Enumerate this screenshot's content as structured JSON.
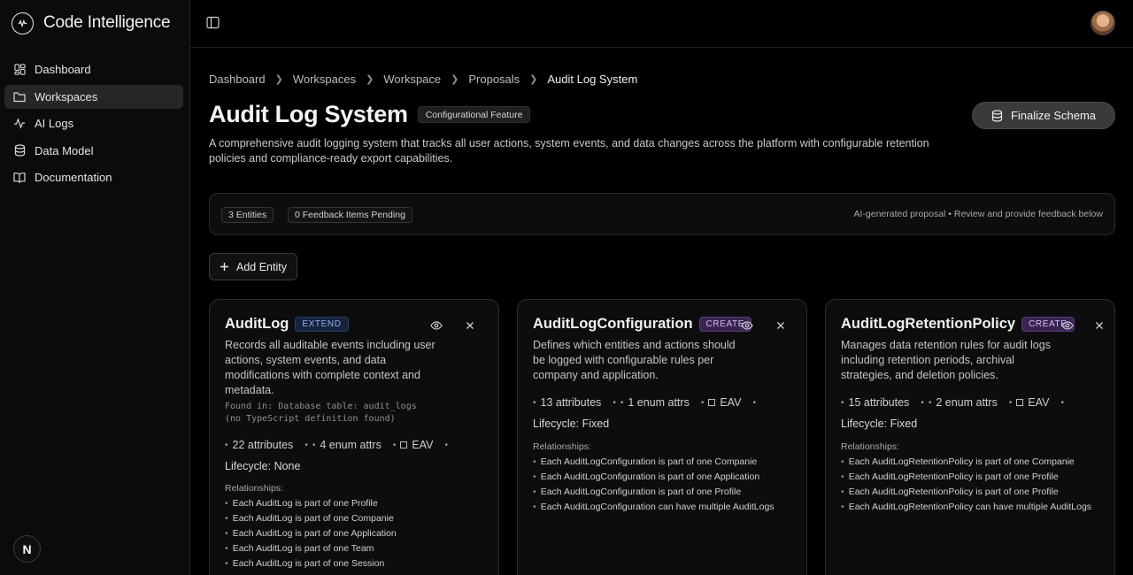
{
  "app": {
    "title": "Code Intelligence"
  },
  "sidebar": {
    "items": [
      {
        "label": "Dashboard",
        "icon": "dashboard-icon",
        "active": false
      },
      {
        "label": "Workspaces",
        "icon": "folder-icon",
        "active": true
      },
      {
        "label": "AI Logs",
        "icon": "activity-icon",
        "active": false
      },
      {
        "label": "Data Model",
        "icon": "database-icon",
        "active": false
      },
      {
        "label": "Documentation",
        "icon": "book-icon",
        "active": false
      }
    ],
    "footer_badge": "N"
  },
  "breadcrumb": [
    "Dashboard",
    "Workspaces",
    "Workspace",
    "Proposals",
    "Audit Log System"
  ],
  "page": {
    "title": "Audit Log System",
    "badge": "Configurational Feature",
    "finalize_label": "Finalize Schema",
    "description": "A comprehensive audit logging system that tracks all user actions, system events, and data changes across the platform with configurable retention policies and compliance-ready export capabilities."
  },
  "summary": {
    "entities": "3 Entities",
    "feedback": "0 Feedback Items Pending",
    "note": "AI-generated proposal • Review and provide feedback below"
  },
  "add_entity_label": "Add Entity",
  "cards": [
    {
      "name": "AuditLog",
      "op": "EXTEND",
      "description": "Records all auditable events including user actions, system events, and data modifications with complete context and metadata.",
      "found": "Found in: Database table: audit_logs\n(no TypeScript definition found)",
      "attributes": "22 attributes",
      "enum_attrs": "4 enum attrs",
      "eav": "EAV",
      "lifecycle": "Lifecycle: None",
      "relationships_title": "Relationships:",
      "relationships": [
        "Each AuditLog is part of one Profile",
        "Each AuditLog is part of one Companie",
        "Each AuditLog is part of one Application",
        "Each AuditLog is part of one Team",
        "Each AuditLog is part of one Session"
      ]
    },
    {
      "name": "AuditLogConfiguration",
      "op": "CREATE",
      "description": "Defines which entities and actions should be logged with configurable rules per company and application.",
      "attributes": "13 attributes",
      "enum_attrs": "1 enum attrs",
      "eav": "EAV",
      "lifecycle": "Lifecycle: Fixed",
      "relationships_title": "Relationships:",
      "relationships": [
        "Each AuditLogConfiguration is part of one Companie",
        "Each AuditLogConfiguration is part of one Application",
        "Each AuditLogConfiguration is part of one Profile",
        "Each AuditLogConfiguration can have multiple AuditLogs"
      ]
    },
    {
      "name": "AuditLogRetentionPolicy",
      "op": "CREATE",
      "description": "Manages data retention rules for audit logs including retention periods, archival strategies, and deletion policies.",
      "attributes": "15 attributes",
      "enum_attrs": "2 enum attrs",
      "eav": "EAV",
      "lifecycle": "Lifecycle: Fixed",
      "relationships_title": "Relationships:",
      "relationships": [
        "Each AuditLogRetentionPolicy is part of one Companie",
        "Each AuditLogRetentionPolicy is part of one Profile",
        "Each AuditLogRetentionPolicy is part of one Profile",
        "Each AuditLogRetentionPolicy can have multiple AuditLogs"
      ]
    }
  ]
}
